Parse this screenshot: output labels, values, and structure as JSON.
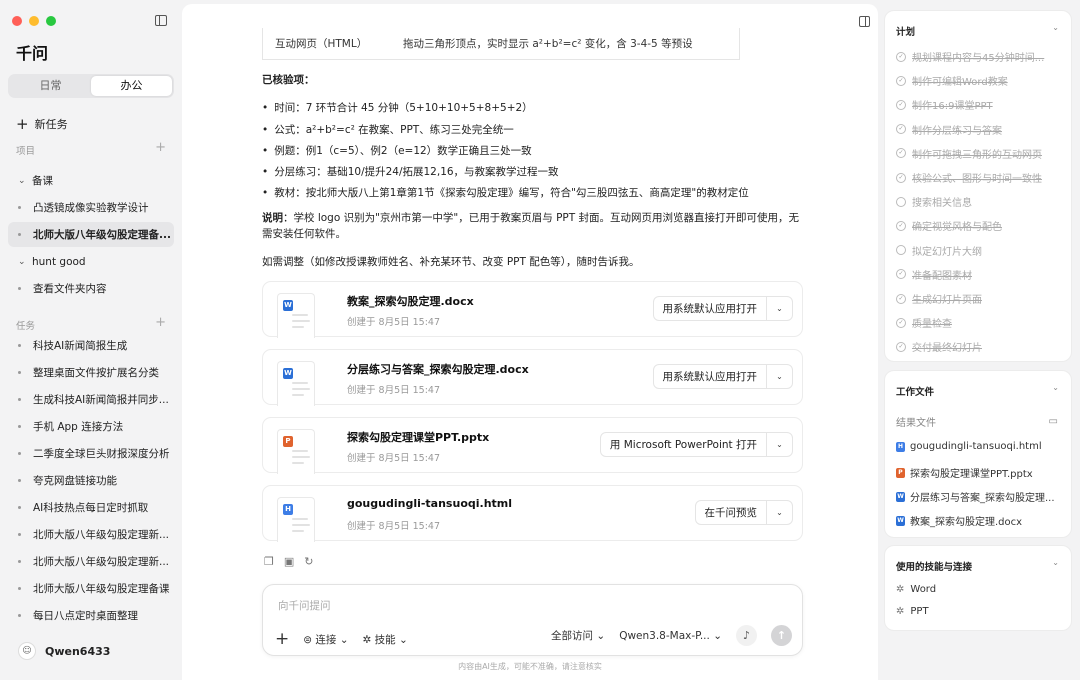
{
  "app": {
    "name": "千问"
  },
  "sidebar": {
    "tabs": [
      {
        "label": "日常",
        "active": false
      },
      {
        "label": "办公",
        "active": true
      }
    ],
    "new_task": "新任务",
    "project_header": "项目",
    "projects": [
      {
        "label": "备课",
        "items": [
          "凸透镜成像实验教学设计",
          "北师大版八年级勾股定理备..."
        ],
        "active_index": 1
      },
      {
        "label": "hunt good",
        "items": [
          "查看文件夹内容"
        ]
      }
    ],
    "task_header": "任务",
    "tasks": [
      "科技AI新闻简报生成",
      "整理桌面文件按扩展名分类",
      "生成科技AI新闻简报并同步...",
      "手机 App 连接方法",
      "二季度全球巨头财报深度分析",
      "夸克网盘链接功能",
      "AI科技热点每日定时抓取",
      "北师大版八年级勾股定理新...",
      "北师大版八年级勾股定理新...",
      "北师大版八年级勾股定理备课",
      "每日八点定时桌面整理"
    ],
    "user": "Qwen6433"
  },
  "main": {
    "table_row": [
      "互动网页（HTML）",
      "拖动三角形顶点，实时显示 a²+b²=c² 变化，含 3-4-5 等预设"
    ],
    "verified_title": "已核验项：",
    "verified_items": [
      "时间：7 环节合计 45 分钟（5+10+10+5+8+5+2）",
      "公式：a²+b²=c² 在教案、PPT、练习三处完全统一",
      "例题：例1（c=5）、例2（e=12）数学正确且三处一致",
      "分层练习：基础10/提升24/拓展12,16，与教案教学过程一致",
      "教材：按北师大版八上第1章第1节《探索勾股定理》编写，符合\"勾三股四弦五、商高定理\"的教材定位"
    ],
    "note_label": "说明",
    "note_text": "：学校 logo 识别为\"京州市第一中学\"，已用于教案页眉与 PPT 封面。互动网页用浏览器直接打开即可使用，无需安装任何软件。",
    "followup": "如需调整（如修改授课教师姓名、补充某环节、改变 PPT 配色等），随时告诉我。",
    "files": [
      {
        "name": "教案_探索勾股定理.docx",
        "date": "创建于 8月5日 15:47",
        "action": "用系统默认应用打开",
        "type": "W",
        "color": "#2b6fd6"
      },
      {
        "name": "分层练习与答案_探索勾股定理.docx",
        "date": "创建于 8月5日 15:47",
        "action": "用系统默认应用打开",
        "type": "W",
        "color": "#2b6fd6"
      },
      {
        "name": "探索勾股定理课堂PPT.pptx",
        "date": "创建于 8月5日 15:47",
        "action": "用 Microsoft PowerPoint 打开",
        "type": "P",
        "color": "#e0632e"
      },
      {
        "name": "gougudingli-tansuoqi.html",
        "date": "创建于 8月5日 15:47",
        "action": "在千问预览",
        "type": "H",
        "color": "#3d7de6"
      }
    ],
    "composer": {
      "placeholder": "向千问提问",
      "connect": "连接",
      "skills": "技能",
      "access": "全部访问",
      "model": "Qwen3.8-Max-P..."
    },
    "disclaimer": "内容由AI生成，可能不准确，请注意核实"
  },
  "plan": {
    "title": "计划",
    "items": [
      {
        "label": "规划课程内容与45分钟时间...",
        "done": true
      },
      {
        "label": "制作可编辑Word教案",
        "done": true
      },
      {
        "label": "制作16:9课堂PPT",
        "done": true
      },
      {
        "label": "制作分层练习与答案",
        "done": true
      },
      {
        "label": "制作可拖拽三角形的互动网页",
        "done": true
      },
      {
        "label": "核验公式、图形与时间一致性",
        "done": true
      },
      {
        "label": "搜索相关信息",
        "done": false
      },
      {
        "label": "确定视觉风格与配色",
        "done": true
      },
      {
        "label": "拟定幻灯片大纲",
        "done": false
      },
      {
        "label": "准备配图素材",
        "done": true
      },
      {
        "label": "生成幻灯片页面",
        "done": true
      },
      {
        "label": "质量检查",
        "done": true
      },
      {
        "label": "交付最终幻灯片",
        "done": true
      }
    ]
  },
  "workfiles": {
    "title": "工作文件",
    "sub": "结果文件",
    "items": [
      {
        "label": "gougudingli-tansuoqi.html",
        "type": "H",
        "color": "#3d7de6"
      },
      {
        "label": "探索勾股定理课堂PPT.pptx",
        "type": "P",
        "color": "#e0632e"
      },
      {
        "label": "分层练习与答案_探索勾股定理...",
        "type": "W",
        "color": "#2b6fd6"
      },
      {
        "label": "教案_探索勾股定理.docx",
        "type": "W",
        "color": "#2b6fd6"
      }
    ]
  },
  "skills": {
    "title": "使用的技能与连接",
    "items": [
      "Word",
      "PPT"
    ]
  }
}
